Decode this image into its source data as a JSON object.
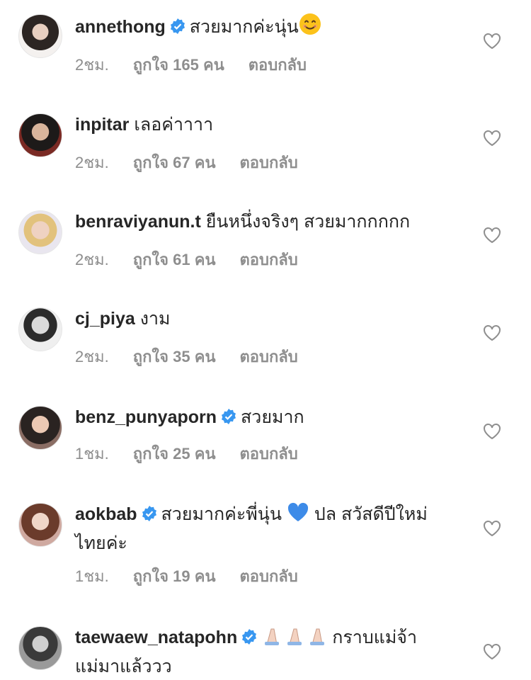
{
  "comments": [
    {
      "username": "annethong",
      "verified": true,
      "text": "สวยมากค่ะนุ่น",
      "emoji": "smiling-face-emoji",
      "time": "2ชม.",
      "likes": "ถูกใจ 165 คน",
      "reply": "ตอบกลับ"
    },
    {
      "username": "inpitar",
      "verified": false,
      "text": "เลอค่าาาา",
      "time": "2ชม.",
      "likes": "ถูกใจ 67 คน",
      "reply": "ตอบกลับ"
    },
    {
      "username": "benraviyanun.t",
      "verified": false,
      "text": "ยืนหนึ่งจริงๆ สวยมากกกกก",
      "time": "2ชม.",
      "likes": "ถูกใจ 61 คน",
      "reply": "ตอบกลับ"
    },
    {
      "username": "cj_piya",
      "verified": false,
      "text": "งาม",
      "time": "2ชม.",
      "likes": "ถูกใจ 35 คน",
      "reply": "ตอบกลับ"
    },
    {
      "username": "benz_punyaporn",
      "verified": true,
      "text": "สวยมาก",
      "time": "1ชม.",
      "likes": "ถูกใจ 25 คน",
      "reply": "ตอบกลับ"
    },
    {
      "username": "aokbab",
      "verified": true,
      "text_before_emoji": "สวยมากค่ะพี่นุ่น",
      "emoji": "blue-heart-emoji",
      "text_after_emoji": "ปล สวัสดีปีใหม่ไทยค่ะ",
      "time": "1ชม.",
      "likes": "ถูกใจ 19 คน",
      "reply": "ตอบกลับ"
    },
    {
      "username": "taewaew_natapohn",
      "verified": true,
      "emoji": "folded-hands-emoji",
      "text": "กราบแม่จ้า แม่มาแล้ววว"
    }
  ],
  "colors": {
    "text": "#262626",
    "meta": "#8e8e8e",
    "verified_badge": "#3897f0",
    "blue_heart": "#3d8be8"
  }
}
